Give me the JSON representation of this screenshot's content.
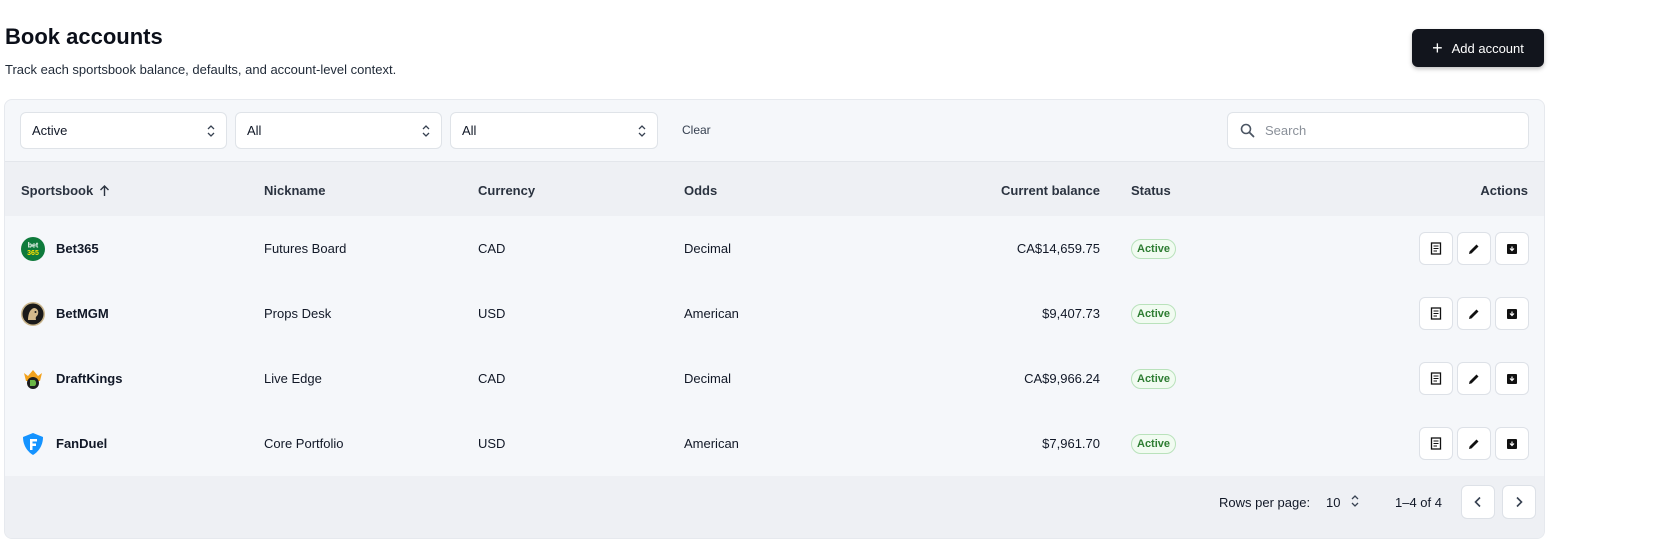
{
  "header": {
    "title": "Book accounts",
    "subtitle": "Track each sportsbook balance, defaults, and account-level context.",
    "add_button_label": "Add account"
  },
  "filters": {
    "status_value": "Active",
    "filter2_value": "All",
    "filter3_value": "All",
    "clear_label": "Clear",
    "search_placeholder": "Search"
  },
  "table": {
    "columns": {
      "sportsbook": "Sportsbook",
      "nickname": "Nickname",
      "currency": "Currency",
      "odds": "Odds",
      "balance": "Current balance",
      "status": "Status",
      "actions": "Actions"
    },
    "sort_icon": "arrow-up-icon",
    "rows": [
      {
        "sportsbook": "Bet365",
        "logo": "bet365-logo",
        "nickname": "Futures Board",
        "currency": "CAD",
        "odds": "Decimal",
        "balance": "CA$14,659.75",
        "status": "Active"
      },
      {
        "sportsbook": "BetMGM",
        "logo": "betmgm-logo",
        "nickname": "Props Desk",
        "currency": "USD",
        "odds": "American",
        "balance": "$9,407.73",
        "status": "Active"
      },
      {
        "sportsbook": "DraftKings",
        "logo": "draftkings-logo",
        "nickname": "Live Edge",
        "currency": "CAD",
        "odds": "Decimal",
        "balance": "CA$9,966.24",
        "status": "Active"
      },
      {
        "sportsbook": "FanDuel",
        "logo": "fanduel-logo",
        "nickname": "Core Portfolio",
        "currency": "USD",
        "odds": "American",
        "balance": "$7,961.70",
        "status": "Active"
      }
    ],
    "row_actions": [
      "receipt-icon",
      "edit-icon",
      "archive-icon"
    ]
  },
  "pagination": {
    "rows_per_page_label": "Rows per page:",
    "rows_per_page_value": "10",
    "range_label": "1–4 of 4"
  },
  "colors": {
    "primary_button": "#12151d",
    "status_active_text": "#2e7d32",
    "status_active_border": "#b9e2bb",
    "surface": "#f5f7fa",
    "header_row": "#eef0f4"
  }
}
